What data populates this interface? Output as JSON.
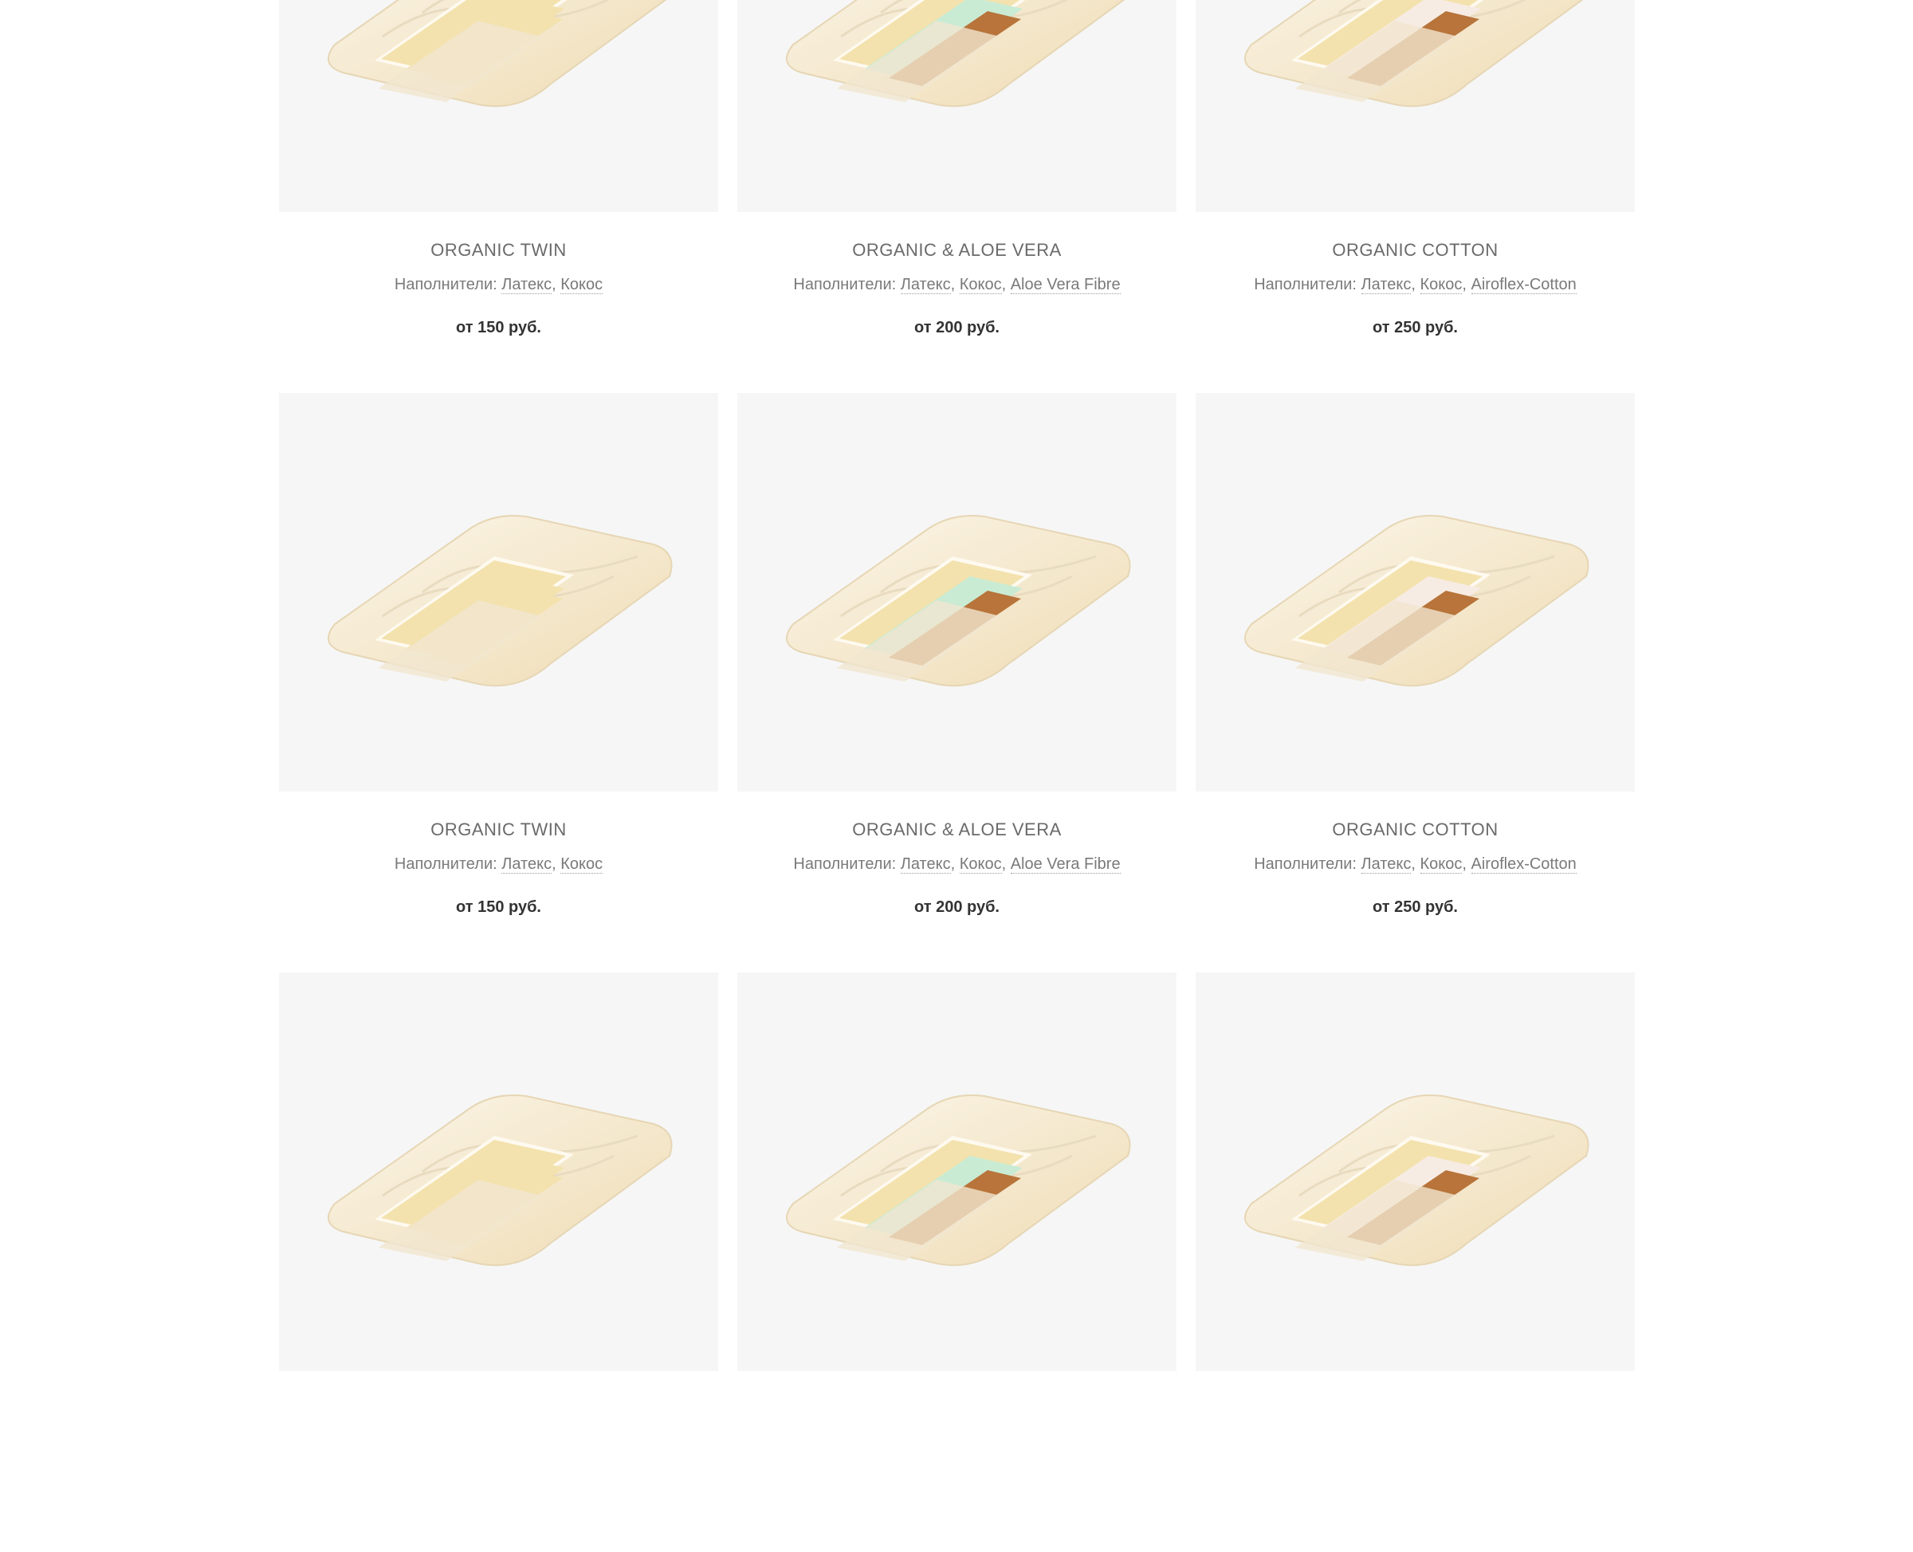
{
  "fillers_label": "Наполнители:",
  "products": [
    {
      "title": "ORGANIC TWIN",
      "fillers": [
        "Латекс",
        "Кокос"
      ],
      "price": "от 150 руб.",
      "core": "twin"
    },
    {
      "title": "ORGANIC & ALOE VERA",
      "fillers": [
        "Латекс",
        "Кокос",
        "Aloe Vera Fibre"
      ],
      "price": "от 200 руб.",
      "core": "aloe"
    },
    {
      "title": "ORGANIC COTTON",
      "fillers": [
        "Латекс",
        "Кокос",
        "Airoflex-Cotton"
      ],
      "price": "от 250 руб.",
      "core": "cotton"
    },
    {
      "title": "ORGANIC TWIN",
      "fillers": [
        "Латекс",
        "Кокос"
      ],
      "price": "от 150 руб.",
      "core": "twin"
    },
    {
      "title": "ORGANIC & ALOE VERA",
      "fillers": [
        "Латекс",
        "Кокос",
        "Aloe Vera Fibre"
      ],
      "price": "от 200 руб.",
      "core": "aloe"
    },
    {
      "title": "ORGANIC COTTON",
      "fillers": [
        "Латекс",
        "Кокос",
        "Airoflex-Cotton"
      ],
      "price": "от 250 руб.",
      "core": "cotton"
    },
    {
      "title": "",
      "fillers": [],
      "price": "",
      "core": "twin"
    },
    {
      "title": "",
      "fillers": [],
      "price": "",
      "core": "aloe"
    },
    {
      "title": "",
      "fillers": [],
      "price": "",
      "core": "cotton"
    }
  ],
  "colors": {
    "card_bg": "#f6f6f6",
    "cover": "#f1e6cf",
    "latex": "#f3e2ad",
    "coconut": "#b8743a",
    "aloe": "#c9ebd4",
    "cotton": "#f7ece4"
  }
}
